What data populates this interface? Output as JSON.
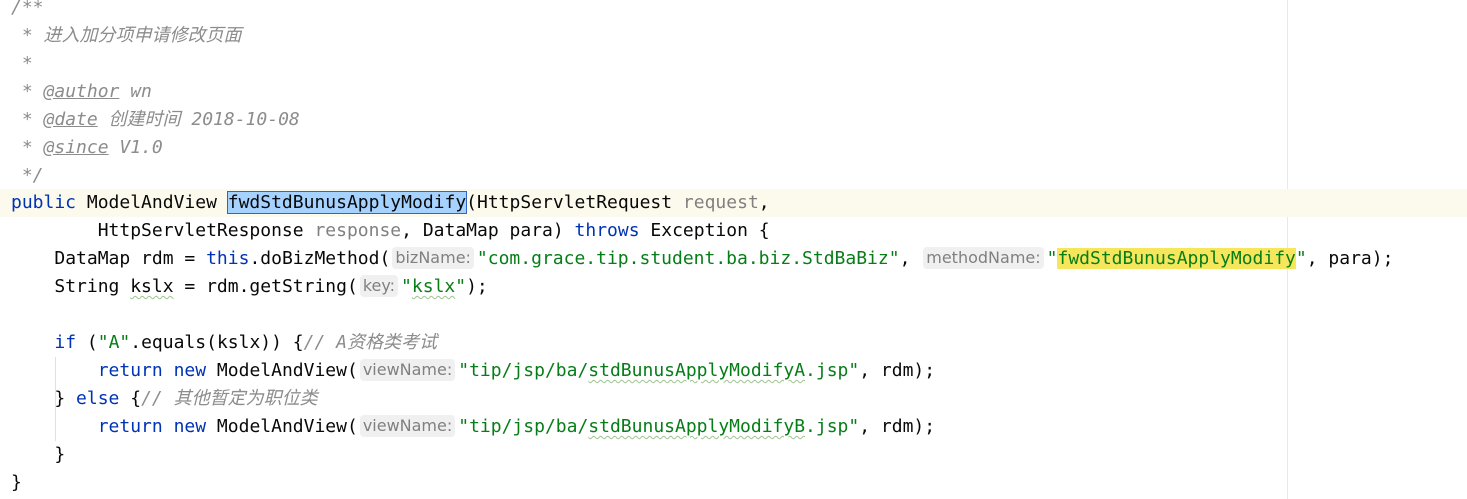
{
  "code": {
    "doc": {
      "open": "/**",
      "title": " * 进入加分项申请修改页面",
      "blank": " *",
      "star": " * ",
      "author_tag": "@author",
      "author_val": " wn",
      "date_tag": "@date",
      "date_val": " 创建时间 2018-10-08",
      "since_tag": "@since",
      "since_val": " V1.0",
      "close": " */"
    },
    "signature": {
      "kw_public": "public",
      "return_type": " ModelAndView ",
      "method_name": "fwdStdBunusApplyModify",
      "open_paren": "(HttpServletRequest ",
      "param_request": "request",
      "comma1": ",",
      "indent2": "        ",
      "type_response": "HttpServletResponse ",
      "param_response": "response",
      "rest": ", DataMap para) ",
      "kw_throws": "throws",
      "exception": " Exception {"
    },
    "line_rdm": {
      "indent": "    ",
      "decl": "DataMap rdm = ",
      "kw_this": "this",
      "call": ".doBizMethod(",
      "hint_biz": "bizName:",
      "str_biz": "\"com.grace.tip.student.ba.biz.StdBaBiz\"",
      "comma": ", ",
      "hint_method": "methodName:",
      "quote_open": "\"",
      "str_method": "fwdStdBunusApplyModify",
      "quote_close": "\"",
      "tail": ", para);"
    },
    "line_kslx": {
      "indent": "    ",
      "decl_a": "String ",
      "var": "kslx",
      "decl_b": " = rdm.getString(",
      "hint_key": "key:",
      "str_q1": "\"",
      "str_key": "kslx",
      "str_q2": "\"",
      "tail": ");"
    },
    "line_if": {
      "indent": "    ",
      "kw_if": "if",
      "p1": " (",
      "str_a": "\"A\"",
      "p2": ".equals(kslx)) {",
      "comment": "// A资格类考试"
    },
    "line_return_a": {
      "indent": "        ",
      "kw_return": "return",
      "sp": " ",
      "kw_new": "new",
      "call": " ModelAndView(",
      "hint": "viewName:",
      "str_q1": "\"tip/jsp/ba/",
      "str_word": "stdBunusApplyModifyA",
      "str_q2": ".jsp\"",
      "tail": ", rdm);"
    },
    "line_else": {
      "indent": "    ",
      "brace": "} ",
      "kw_else": "else",
      "open": " {",
      "comment": "// 其他暂定为职位类"
    },
    "line_return_b": {
      "indent": "        ",
      "kw_return": "return",
      "sp": " ",
      "kw_new": "new",
      "call": " ModelAndView(",
      "hint": "viewName:",
      "str_q1": "\"tip/jsp/ba/",
      "str_word": "stdBunusApplyModifyB",
      "str_q2": ".jsp\"",
      "tail": ", rdm);"
    },
    "close_if": "    }",
    "close_method": "}"
  }
}
